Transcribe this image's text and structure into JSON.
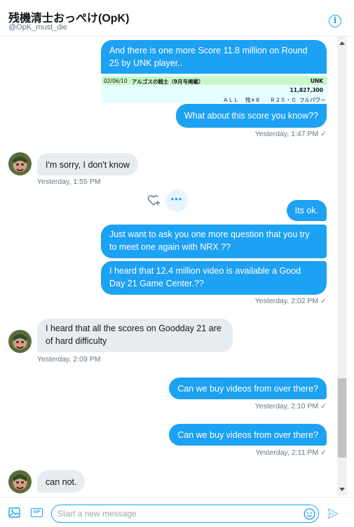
{
  "header": {
    "display_name": "残機清士おっぺけ(OpK)",
    "handle": "@OpK_must_die"
  },
  "embed": {
    "date": "02/06/10",
    "title": "アルゴスの戦士（9月号掲載）",
    "player": "UNK",
    "score": "11,827,300",
    "detail_all": "ＡＬＬ",
    "detail_lives": "残×８",
    "detail_round": "Ｒ２５・０",
    "detail_power": "フルパワー"
  },
  "messages": [
    {
      "dir": "out",
      "text": "And there is one more Score 11.8 million on Round 25 by UNK player.."
    },
    {
      "dir": "out",
      "text": "What about this score you know??"
    },
    {
      "dir": "out",
      "time": "Yesterday, 1:47 PM"
    },
    {
      "dir": "in",
      "text": "I'm sorry, I don't know"
    },
    {
      "dir": "in",
      "time": "Yesterday, 1:55 PM"
    },
    {
      "dir": "out",
      "text": "Its ok."
    },
    {
      "dir": "out",
      "text": "Just want to ask you one more question that you try to meet one again with NRX ??"
    },
    {
      "dir": "out",
      "text": "I heard that 12.4 million video is available a Good Day 21 Game Center.??"
    },
    {
      "dir": "out",
      "time": "Yesterday, 2:02 PM"
    },
    {
      "dir": "in",
      "text": "I heard that all the scores on Goodday 21 are of hard difficulty"
    },
    {
      "dir": "in",
      "time": "Yesterday, 2:09 PM"
    },
    {
      "dir": "out",
      "text": "Can we buy videos from over there?"
    },
    {
      "dir": "out",
      "time": "Yesterday, 2:10 PM"
    },
    {
      "dir": "out",
      "text": "Can we buy videos from over there?"
    },
    {
      "dir": "out",
      "time": "Yesterday, 2:11 PM"
    },
    {
      "dir": "in",
      "text": "can not."
    }
  ],
  "read_check": "✓",
  "more_label": "•••",
  "composer": {
    "placeholder": "Start a new message",
    "gif_label": "GIF"
  },
  "colors": {
    "accent": "#1da1f2",
    "incoming_bubble": "#e6ecf0",
    "timestamp": "#657786"
  },
  "icons": [
    "info-icon",
    "heart-plus-icon",
    "more-icon",
    "media-icon",
    "gif-icon",
    "emoji-icon",
    "send-icon"
  ]
}
